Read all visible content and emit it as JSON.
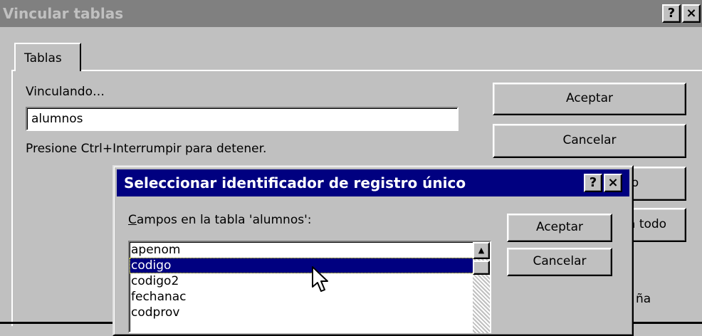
{
  "outer_window": {
    "title": "Vincular tablas",
    "help_button": "?",
    "close_button": "×"
  },
  "tabs": [
    {
      "label": "Tablas"
    }
  ],
  "main": {
    "linking_label": "Vinculando…",
    "table_value": "alumnos",
    "status_text": "Presione Ctrl+Interrumpir para detener.",
    "buttons": {
      "accept": "Aceptar",
      "cancel": "Cancelar",
      "partial_3": "lo",
      "partial_4": "a todo",
      "partial_5": "ña"
    }
  },
  "dialog": {
    "title": "Seleccionar identificador de registro único",
    "help_button": "?",
    "close_button": "×",
    "fields_label_hotkey": "C",
    "fields_label_rest": "ampos en la tabla 'alumnos':",
    "accept": "Aceptar",
    "cancel": "Cancelar",
    "fields": [
      "apenom",
      "codigo",
      "codigo2",
      "fechanac",
      "codprov"
    ],
    "selected_field": "codigo"
  },
  "icons": {
    "cursor": "arrow-pointer-icon",
    "scroll_up": "up-arrow-icon"
  }
}
